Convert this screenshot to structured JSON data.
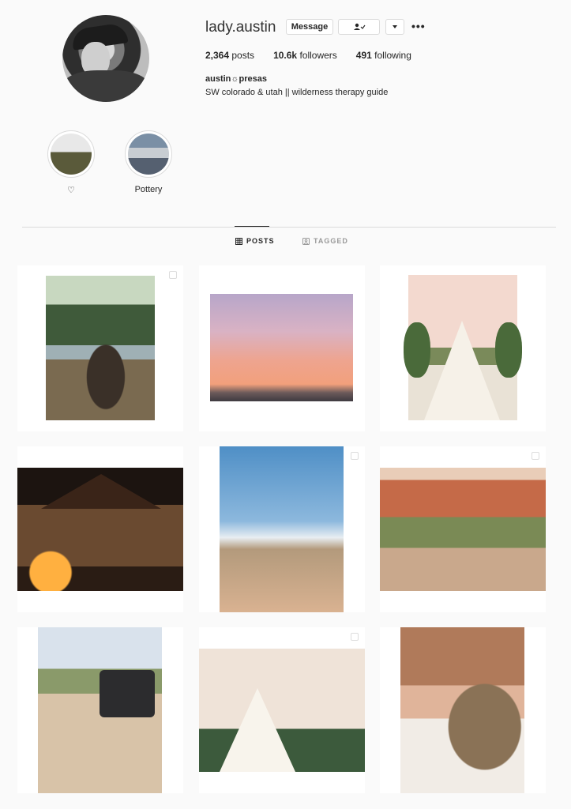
{
  "profile": {
    "username": "lady.austin",
    "message_label": "Message",
    "following_icon": "person-check-icon",
    "dropdown_icon": "caret-down-icon",
    "more_label": "•••",
    "stats": {
      "posts": "2,364",
      "posts_label": "posts",
      "followers": "10.6k",
      "followers_label": "followers",
      "following": "491",
      "following_label": "following"
    },
    "full_name": "austin☼presas",
    "bio": "SW colorado & utah || wilderness therapy guide"
  },
  "highlights": [
    {
      "label": "♡"
    },
    {
      "label": "Pottery"
    }
  ],
  "tabs": [
    {
      "label": "POSTS",
      "icon": "grid-icon",
      "active": true
    },
    {
      "label": "TAGGED",
      "icon": "tag-icon",
      "active": false
    }
  ],
  "colors": {
    "background": "#fafafa",
    "text": "#262626",
    "border": "#dbdbdb",
    "muted": "#999999"
  }
}
